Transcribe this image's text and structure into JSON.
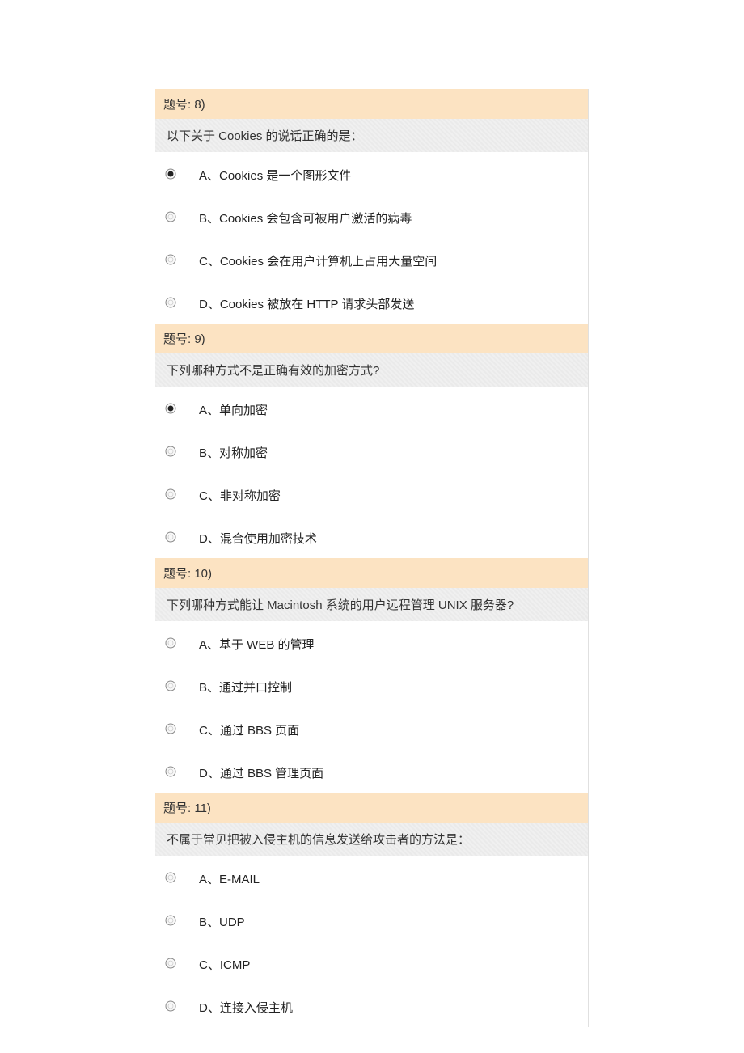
{
  "questions": [
    {
      "header": "题号: 8)",
      "text": "以下关于 Cookies 的说话正确的是：",
      "selected": 0,
      "options": [
        "A、Cookies 是一个图形文件",
        "B、Cookies 会包含可被用户激活的病毒",
        "C、Cookies 会在用户计算机上占用大量空间",
        "D、Cookies 被放在 HTTP 请求头部发送"
      ]
    },
    {
      "header": "题号: 9)",
      "text": "下列哪种方式不是正确有效的加密方式?",
      "selected": 0,
      "options": [
        "A、单向加密",
        "B、对称加密",
        "C、非对称加密",
        "D、混合使用加密技术"
      ]
    },
    {
      "header": "题号: 10)",
      "text": "下列哪种方式能让 Macintosh 系统的用户远程管理 UNIX 服务器?",
      "selected": -1,
      "options": [
        "A、基于 WEB 的管理",
        "B、通过并口控制",
        "C、通过 BBS 页面",
        "D、通过 BBS 管理页面"
      ]
    },
    {
      "header": "题号: 11)",
      "text": "不属于常见把被入侵主机的信息发送给攻击者的方法是：",
      "selected": -1,
      "options": [
        "A、E-MAIL",
        "B、UDP",
        "C、ICMP",
        "D、连接入侵主机"
      ]
    }
  ]
}
